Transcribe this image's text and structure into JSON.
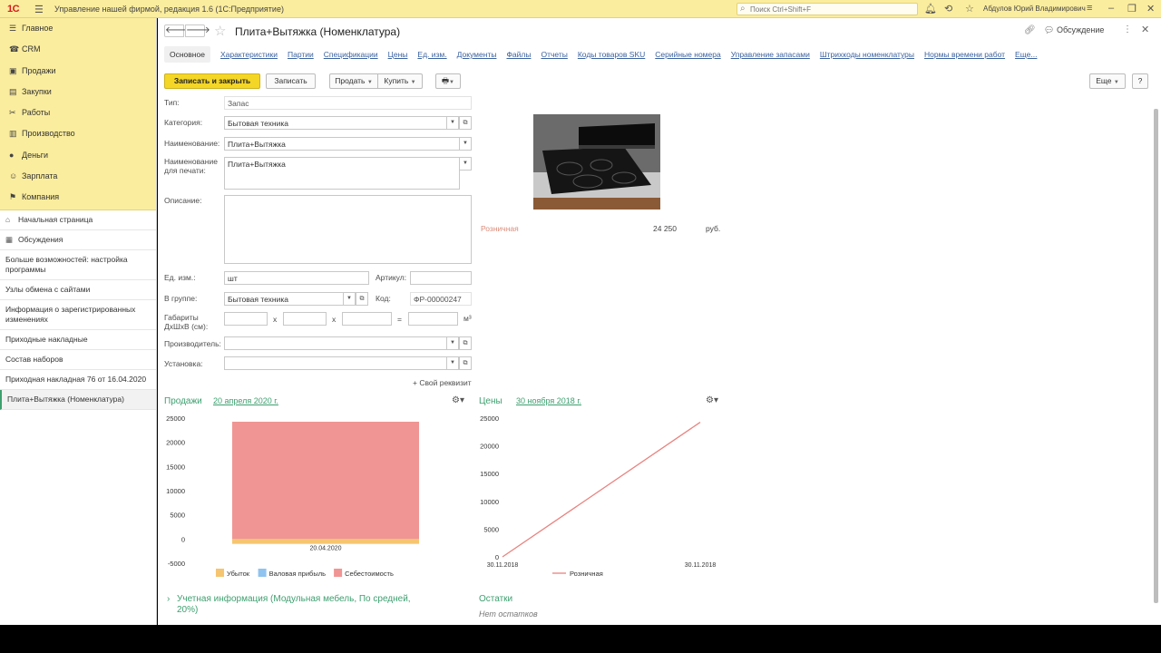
{
  "topbar": {
    "logo": "1С",
    "app_title": "Управление нашей фирмой, редакция 1.6  (1С:Предприятие)",
    "search_placeholder": "Поиск Ctrl+Shift+F",
    "user": "Абдулов Юрий Владимирович"
  },
  "sections": [
    {
      "label": "Главное",
      "icon": "menu-icon"
    },
    {
      "label": "CRM",
      "icon": "crm-icon"
    },
    {
      "label": "Продажи",
      "icon": "sales-icon"
    },
    {
      "label": "Закупки",
      "icon": "purchases-icon"
    },
    {
      "label": "Работы",
      "icon": "works-icon"
    },
    {
      "label": "Производство",
      "icon": "production-icon"
    },
    {
      "label": "Деньги",
      "icon": "money-icon"
    },
    {
      "label": "Зарплата",
      "icon": "salary-icon"
    },
    {
      "label": "Компания",
      "icon": "company-icon"
    }
  ],
  "nav": [
    {
      "label": "Начальная страница",
      "icon": "home-icon"
    },
    {
      "label": "Обсуждения",
      "icon": "discussions-icon"
    },
    {
      "label": "Больше возможностей: настройка программы"
    },
    {
      "label": "Узлы обмена с сайтами"
    },
    {
      "label": "Информация о зарегистрированных изменениях"
    },
    {
      "label": "Приходные накладные"
    },
    {
      "label": "Состав наборов"
    },
    {
      "label": "Приходная накладная 76 от 16.04.2020"
    },
    {
      "label": "Плита+Вытяжка (Номенклатура)",
      "active": true
    }
  ],
  "header": {
    "title": "Плита+Вытяжка (Номенклатура)",
    "discussion": "Обсуждение"
  },
  "tabs": [
    "Основное",
    "Характеристики",
    "Партии",
    "Спецификации",
    "Цены",
    "Ед. изм.",
    "Документы",
    "Файлы",
    "Отчеты",
    "Коды товаров SKU",
    "Серийные номера",
    "Управление запасами",
    "Штрихкоды номенклатуры",
    "Нормы времени работ",
    "Еще..."
  ],
  "toolbar": {
    "save_close": "Записать и закрыть",
    "save": "Записать",
    "sell": "Продать",
    "buy": "Купить",
    "more": "Еще",
    "help": "?"
  },
  "form": {
    "type_label": "Тип:",
    "type_value": "Запас",
    "category_label": "Категория:",
    "category_value": "Бытовая техника",
    "name_label": "Наименование:",
    "name_value": "Плита+Вытяжка",
    "print_name_label_1": "Наименование",
    "print_name_label_2": "для печати:",
    "print_name_value": "Плита+Вытяжка",
    "description_label": "Описание:",
    "unit_label": "Ед. изм.:",
    "unit_value": "шт",
    "article_label": "Артикул:",
    "group_label": "В группе:",
    "group_value": "Бытовая техника",
    "code_label": "Код:",
    "code_value": "ФР-00000247",
    "dims_label_1": "Габариты",
    "dims_label_2": "ДхШхВ (см):",
    "x1": "x",
    "x2": "x",
    "eq": "=",
    "volume_unit": "м³",
    "manufacturer_label": "Производитель:",
    "installation_label": "Установка:",
    "own_attr": "+ Свой реквизит"
  },
  "price": {
    "kind": "Розничная",
    "value": "24 250",
    "currency": "руб."
  },
  "sales_section": {
    "title": "Продажи",
    "date": "20 апреля 2020 г."
  },
  "prices_section": {
    "title": "Цены",
    "date": "30 ноября 2018 г."
  },
  "chart_data": [
    {
      "type": "bar",
      "stacked": true,
      "categories": [
        "20.04.2020"
      ],
      "series": [
        {
          "name": "Убыток",
          "values": [
            -1000
          ],
          "color": "#f6c56f"
        },
        {
          "name": "Валовая прибыль",
          "values": [
            0
          ],
          "color": "#8fc3f0"
        },
        {
          "name": "Себестоимость",
          "values": [
            24250
          ],
          "color": "#f09593"
        }
      ],
      "y_ticks": [
        "25000",
        "20000",
        "15000",
        "10000",
        "5000",
        "0",
        "-5000"
      ],
      "ylim": [
        -5000,
        25000
      ],
      "legend": "bottom"
    },
    {
      "type": "line",
      "x": [
        "30.11.2018",
        "30.11.2018"
      ],
      "series": [
        {
          "name": "Розничная",
          "values": [
            0,
            24250
          ],
          "color": "#e8837f"
        }
      ],
      "y_ticks": [
        "25000",
        "20000",
        "15000",
        "10000",
        "5000",
        "0"
      ],
      "ylim": [
        0,
        25000
      ],
      "legend": "bottom"
    }
  ],
  "accounting": {
    "text": "Учетная информация (Модульная мебель, По средней, 20%)"
  },
  "remains": {
    "title": "Остатки",
    "text": "Нет остатков"
  }
}
